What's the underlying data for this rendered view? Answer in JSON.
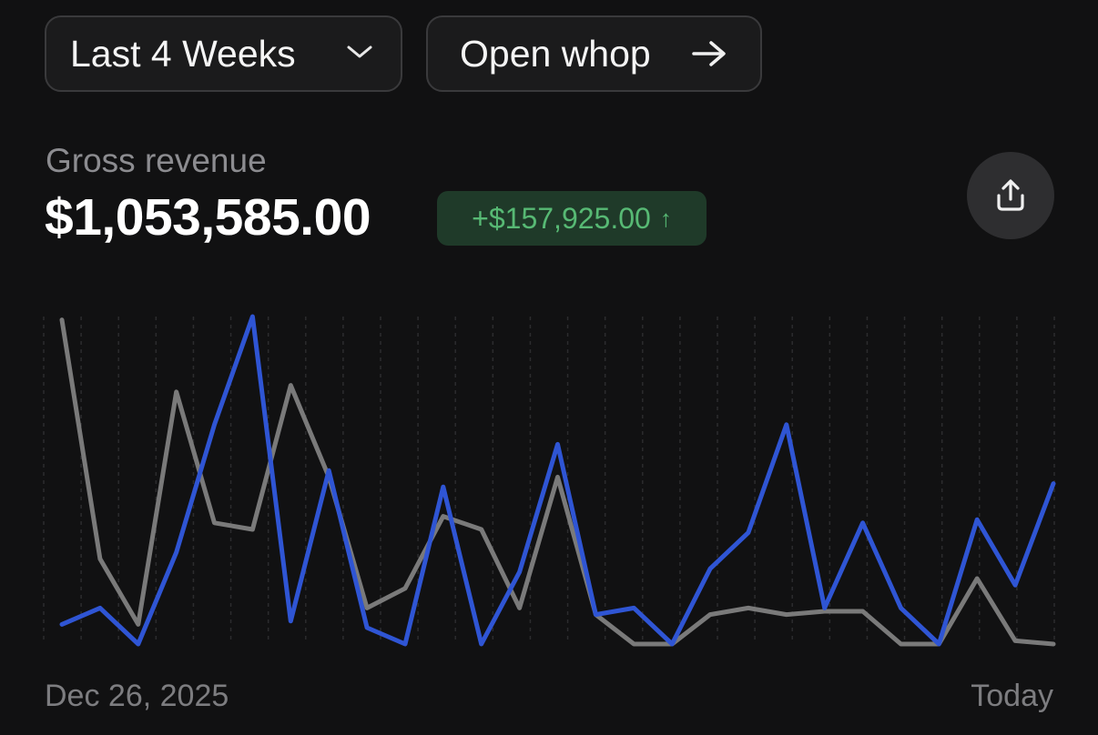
{
  "controls": {
    "range_label": "Last 4 Weeks",
    "open_label": "Open whop"
  },
  "metric": {
    "label": "Gross revenue",
    "value": "$1,053,585.00",
    "delta": "+$157,925.00",
    "delta_arrow": "↑"
  },
  "icons": {
    "range": "chevron-down-icon",
    "open": "arrow-right-icon",
    "share": "share-icon"
  },
  "colors": {
    "current_series": "#2f55d4",
    "previous_series": "#7a7a7a",
    "delta_text": "#57b974",
    "delta_bg": "#1f3a29"
  },
  "chart_data": {
    "type": "line",
    "x_start_label": "Dec 26, 2025",
    "x_end_label": "Today",
    "ylim": [
      0,
      100
    ],
    "grid": "vertical dashed",
    "series": [
      {
        "values": [
          6,
          11,
          0,
          28,
          67,
          100,
          7,
          53,
          5,
          0,
          48,
          0,
          22,
          61,
          9,
          11,
          0,
          23,
          34,
          67,
          11,
          37,
          11,
          0,
          38,
          18,
          49
        ]
      },
      {
        "values": [
          99,
          26,
          6,
          77,
          37,
          35,
          79,
          51,
          11,
          17,
          39,
          35,
          11,
          51,
          9,
          0,
          0,
          9,
          11,
          9,
          10,
          10,
          0,
          0,
          20,
          1,
          0
        ]
      }
    ]
  }
}
